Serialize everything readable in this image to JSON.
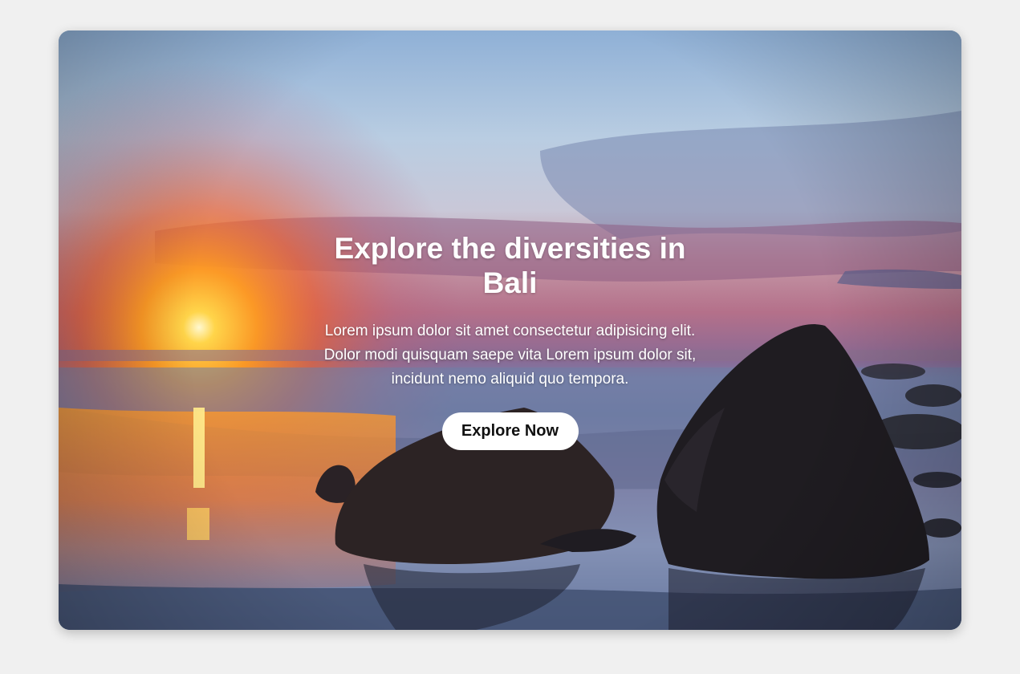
{
  "hero": {
    "title": "Explore the diversities in Bali",
    "description": "Lorem ipsum dolor sit amet consectetur adipisicing elit. Dolor modi quisquam saepe vita Lorem ipsum dolor sit, incidunt nemo aliquid quo tempora.",
    "button_label": "Explore Now"
  },
  "colors": {
    "page_background": "#f0f0f0",
    "button_background": "#ffffff",
    "button_text": "#111111",
    "text": "#ffffff"
  }
}
